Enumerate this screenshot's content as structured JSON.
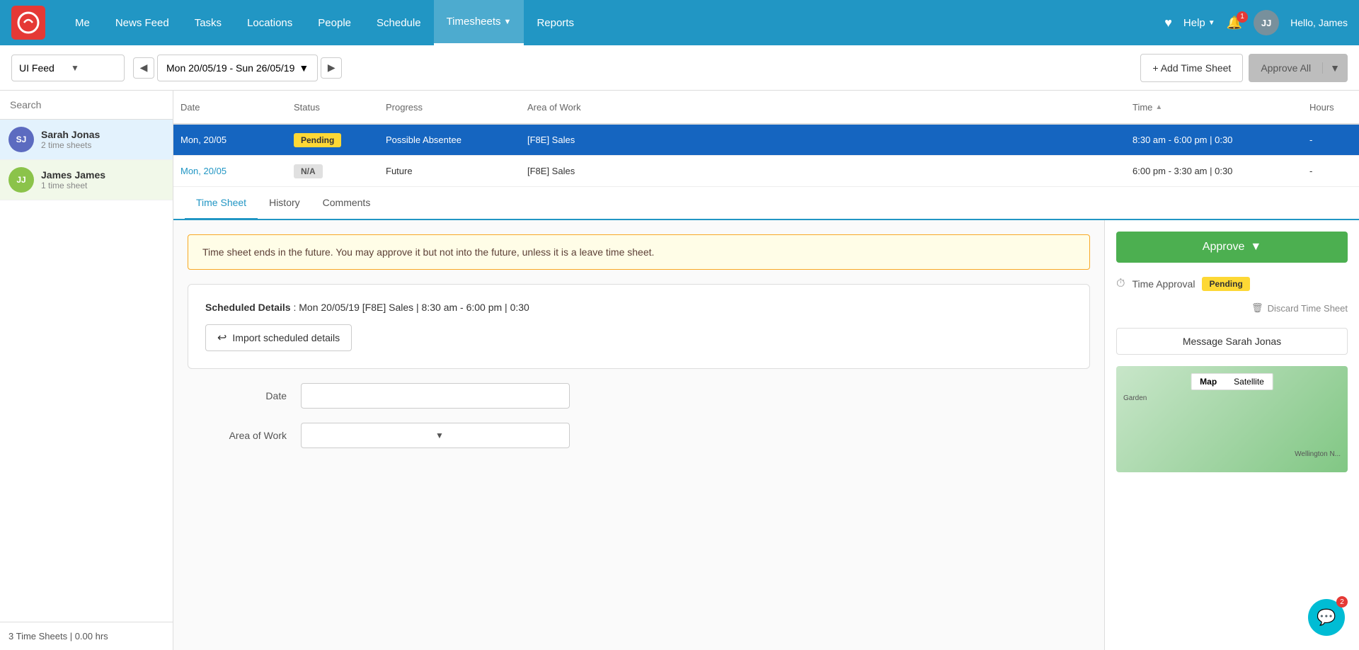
{
  "brand": {
    "logo_text": "Q",
    "logo_bg": "#e53935"
  },
  "nav": {
    "links": [
      {
        "id": "me",
        "label": "Me",
        "active": false
      },
      {
        "id": "news-feed",
        "label": "News Feed",
        "active": false
      },
      {
        "id": "tasks",
        "label": "Tasks",
        "active": false
      },
      {
        "id": "locations",
        "label": "Locations",
        "active": false
      },
      {
        "id": "people",
        "label": "People",
        "active": false
      },
      {
        "id": "schedule",
        "label": "Schedule",
        "active": false
      },
      {
        "id": "timesheets",
        "label": "Timesheets",
        "active": true,
        "has_dropdown": true
      },
      {
        "id": "reports",
        "label": "Reports",
        "active": false
      }
    ],
    "help_label": "Help",
    "notification_count": "1",
    "avatar_initials": "JJ",
    "greeting": "Hello, James",
    "chat_badge": "2"
  },
  "toolbar": {
    "feed_label": "UI Feed",
    "date_range": "Mon 20/05/19 - Sun 26/05/19",
    "add_timesheet_label": "+ Add Time Sheet",
    "approve_all_label": "Approve All"
  },
  "table": {
    "headers": [
      "Date",
      "Status",
      "Progress",
      "Area of Work",
      "Time",
      "Hours"
    ],
    "rows": [
      {
        "date": "Mon, 20/05",
        "status": "Pending",
        "status_type": "pending",
        "progress": "Possible Absentee",
        "area_of_work": "[F8E] Sales",
        "time": "8:30 am - 6:00 pm | 0:30",
        "hours": "-",
        "selected": true
      },
      {
        "date": "Mon, 20/05",
        "status": "N/A",
        "status_type": "na",
        "progress": "Future",
        "area_of_work": "[F8E] Sales",
        "time": "6:00 pm - 3:30 am | 0:30",
        "hours": "-",
        "selected": false
      }
    ]
  },
  "sidebar": {
    "search_placeholder": "Search",
    "people": [
      {
        "id": "sarah-jonas",
        "initials": "SJ",
        "avatar_bg": "#5c6bc0",
        "name": "Sarah Jonas",
        "sheets": "2 time sheets",
        "active": true
      },
      {
        "id": "james-james",
        "initials": "JJ",
        "avatar_bg": "#8bc34a",
        "name": "James James",
        "sheets": "1 time sheet",
        "active": false,
        "selected_green": true
      }
    ],
    "footer_text": "3 Time Sheets | 0.00 hrs"
  },
  "tabs": [
    {
      "id": "time-sheet",
      "label": "Time Sheet",
      "active": true
    },
    {
      "id": "history",
      "label": "History",
      "active": false
    },
    {
      "id": "comments",
      "label": "Comments",
      "active": false
    }
  ],
  "panel": {
    "info_message": "Time sheet ends in the future. You may approve it but not into the future, unless it is a leave time sheet.",
    "scheduled_details_label": "Scheduled Details",
    "scheduled_details_value": ": Mon 20/05/19 [F8E] Sales | 8:30 am - 6:00 pm | 0:30",
    "import_btn_label": "Import scheduled details",
    "date_label": "Date",
    "area_of_work_label": "Area of Work",
    "approve_btn_label": "Approve",
    "time_approval_label": "Time Approval",
    "pending_label": "Pending",
    "discard_label": "Discard Time Sheet",
    "message_btn_label": "Message Sarah Jonas",
    "map_tab_map": "Map",
    "map_tab_satellite": "Satellite",
    "map_location1": "Wellington N...",
    "map_location2": "Garden"
  }
}
